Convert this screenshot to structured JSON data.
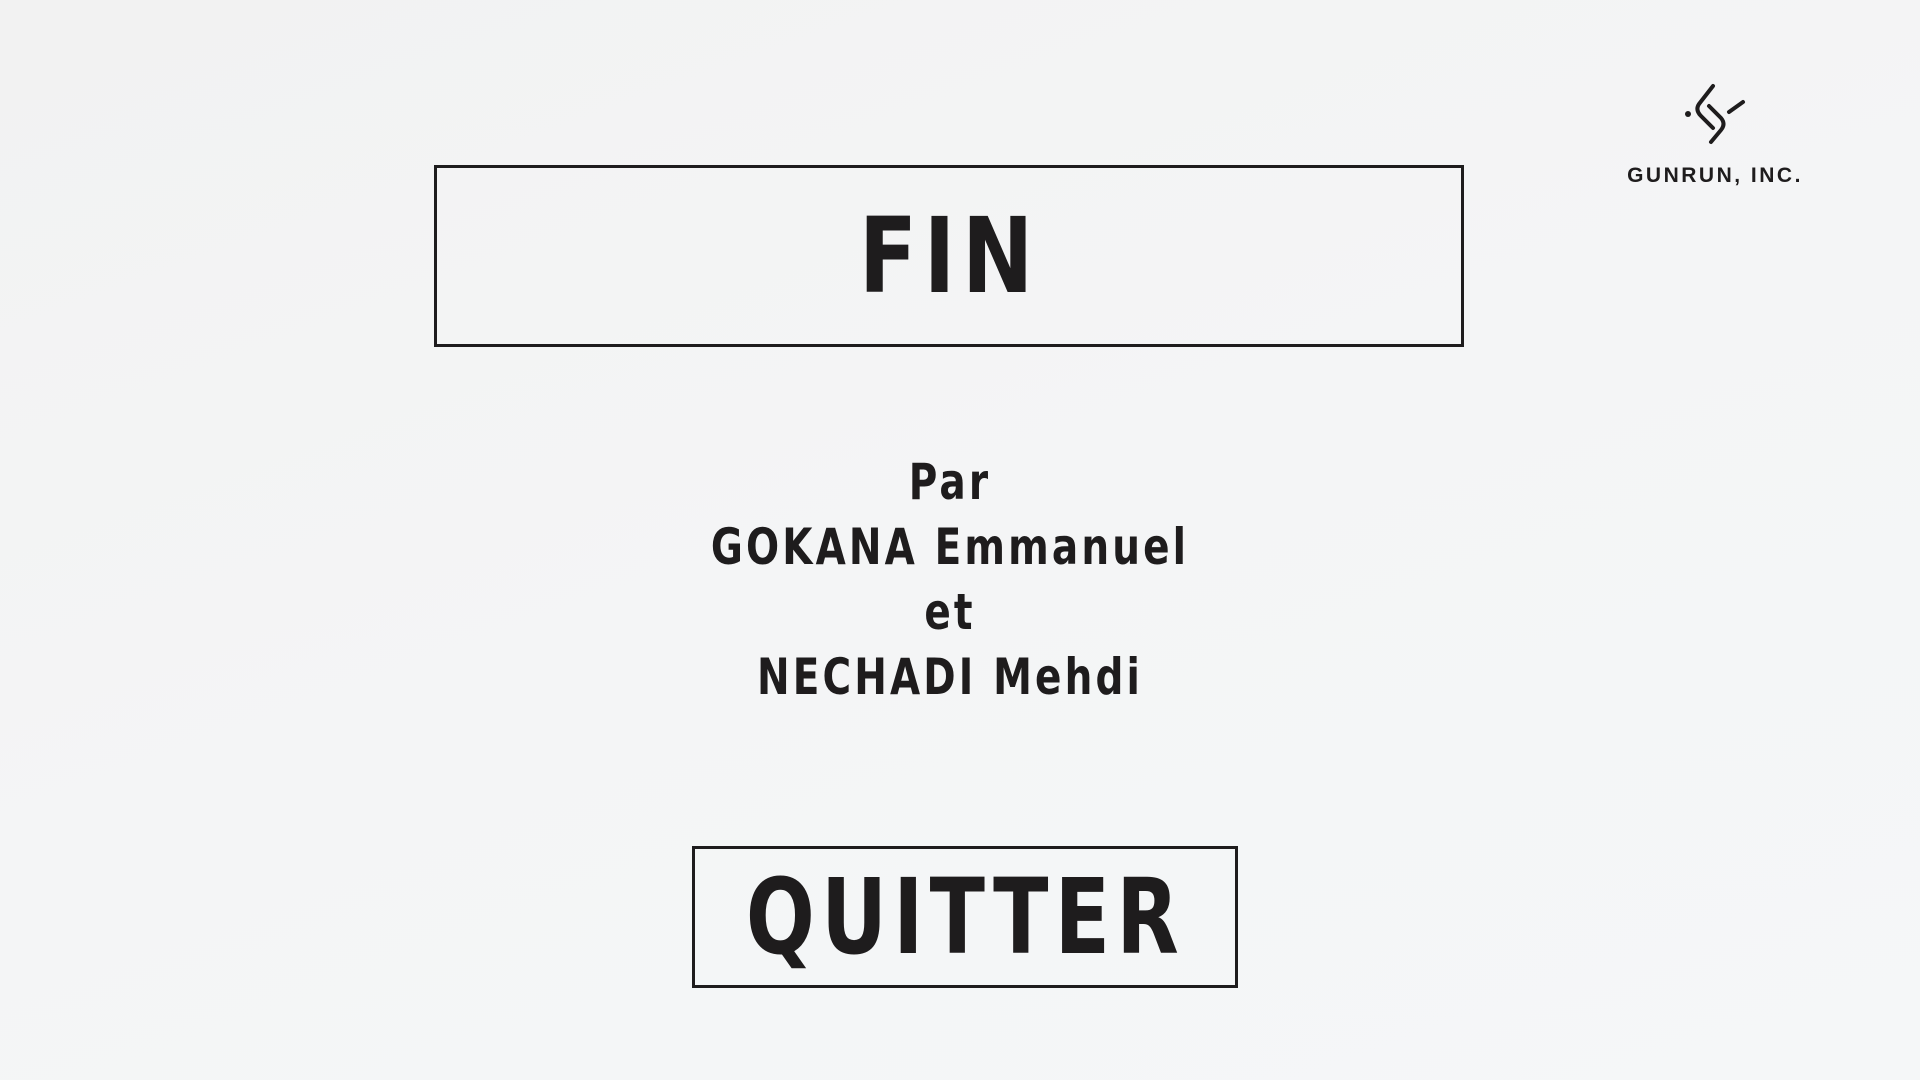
{
  "title": "FIN",
  "credits": {
    "line1": "Par",
    "line2": "GOKANA Emmanuel",
    "line3": "et",
    "line4": "NECHADI Mehdi"
  },
  "quit_button": {
    "label": "QUITTER"
  },
  "brand": {
    "name": "GUNRUN, INC.",
    "logo_icon": "gunrun-logo-icon"
  },
  "colors": {
    "text": "#1e1c1d",
    "background": "#f3f4f5"
  }
}
